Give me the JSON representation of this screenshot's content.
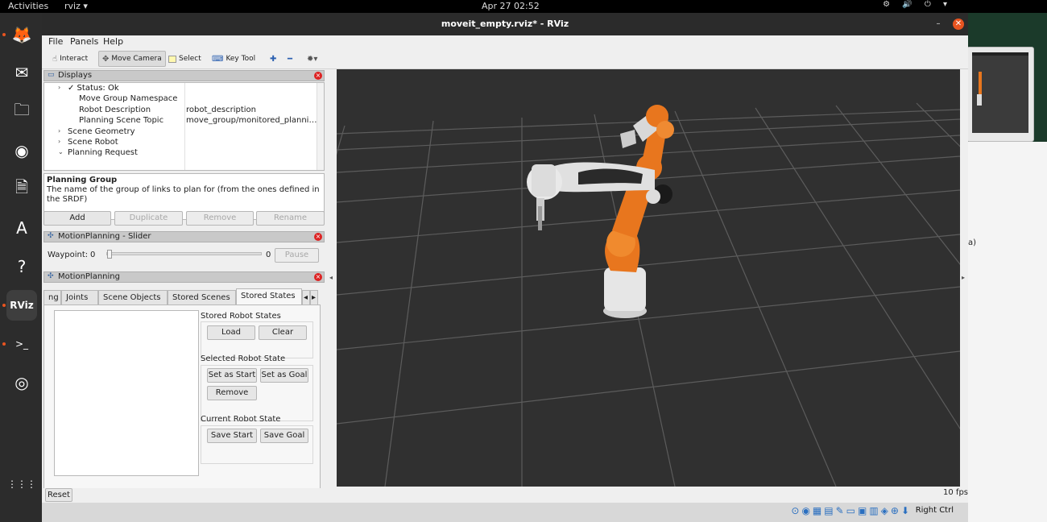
{
  "topbar": {
    "activities": "Activities",
    "app": "rviz ▾",
    "clock": "Apr 27  02:52",
    "tray": "⚙ 🔊 ⏻ ▾"
  },
  "dock": {
    "items": [
      {
        "name": "firefox-icon",
        "glyph": "🦊"
      },
      {
        "name": "thunderbird-icon",
        "glyph": "✉"
      },
      {
        "name": "files-icon",
        "glyph": "🗀"
      },
      {
        "name": "rhythmbox-icon",
        "glyph": "◉"
      },
      {
        "name": "writer-icon",
        "glyph": "🗎"
      },
      {
        "name": "software-icon",
        "glyph": "A"
      },
      {
        "name": "help-icon",
        "glyph": "?"
      },
      {
        "name": "rviz-icon",
        "glyph": "RViz"
      },
      {
        "name": "terminal-icon",
        "glyph": ">_"
      },
      {
        "name": "dvd-icon",
        "glyph": "◎"
      },
      {
        "name": "app-grid-icon",
        "glyph": "⋮⋮⋮"
      }
    ]
  },
  "window": {
    "title": "moveit_empty.rviz* - RViz",
    "minimize": "–",
    "close": "✕"
  },
  "menu": {
    "file": "File",
    "panels": "Panels",
    "help": "Help"
  },
  "toolbar": {
    "interact": "Interact",
    "move_camera": "Move Camera",
    "select": "Select",
    "key_tool": "Key Tool"
  },
  "displays": {
    "title": "Displays",
    "rows": [
      {
        "key": "✓ Status: Ok",
        "value": "",
        "arrow": "›"
      },
      {
        "key": "Move Group Namespace",
        "value": "",
        "arrow": ""
      },
      {
        "key": "Robot Description",
        "value": "robot_description",
        "arrow": ""
      },
      {
        "key": "Planning Scene Topic",
        "value": "move_group/monitored_planni…",
        "arrow": ""
      },
      {
        "key": "Scene Geometry",
        "value": "",
        "arrow": "›"
      },
      {
        "key": "Scene Robot",
        "value": "",
        "arrow": "›"
      },
      {
        "key": "Planning Request",
        "value": "",
        "arrow": "⌄"
      }
    ],
    "desc_title": "Planning Group",
    "desc_text": "The name of the group of links to plan for (from the ones defined in the SRDF)",
    "buttons": {
      "add": "Add",
      "duplicate": "Duplicate",
      "remove": "Remove",
      "rename": "Rename"
    }
  },
  "slider_panel": {
    "title": "MotionPlanning - Slider",
    "waypoint_label": "Waypoint:",
    "min": "0",
    "max": "0",
    "pause": "Pause",
    "position": 0
  },
  "motion_panel": {
    "title": "MotionPlanning",
    "tabs": [
      "ng",
      "Joints",
      "Scene Objects",
      "Stored Scenes",
      "Stored States"
    ],
    "selected_tab": "Stored States",
    "stored_robot_states": "Stored Robot States",
    "load": "Load",
    "clear": "Clear",
    "selected_robot_state": "Selected Robot State",
    "set_as_start": "Set as Start",
    "set_as_goal": "Set as Goal",
    "remove": "Remove",
    "current_robot_state": "Current Robot State",
    "save_start": "Save Start",
    "save_goal": "Save Goal"
  },
  "status": {
    "reset": "Reset",
    "fps": "10 fps"
  },
  "hostbar": {
    "right_ctrl": "Right Ctrl"
  },
  "background": {
    "text": "a)"
  },
  "colors": {
    "robot_orange": "#e8761e",
    "robot_white": "#e6e6e6",
    "viewport": "#303030",
    "grid": "#5a5a5a",
    "accent": "#e95420"
  }
}
